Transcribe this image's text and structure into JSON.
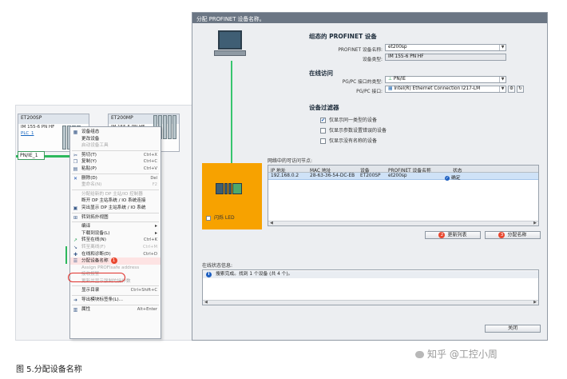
{
  "network": {
    "plc1": {
      "name": "ET200SP",
      "type": "IM 155-6 PN HF",
      "link": "PLC_1"
    },
    "plc2": {
      "name": "ET200MP",
      "type": "IM 155-5 PN HF"
    },
    "subnet": "PN/IE_1"
  },
  "context_menu": {
    "items": [
      {
        "label": "设备组态",
        "shortcut": "",
        "disabled": false,
        "icon": "device-config-icon"
      },
      {
        "label": "更改设备",
        "shortcut": "",
        "disabled": false
      },
      {
        "label": "启动设备工具",
        "shortcut": "",
        "disabled": true
      },
      {
        "sep": true
      },
      {
        "label": "剪切(T)",
        "shortcut": "Ctrl+X",
        "disabled": false,
        "icon": "scissors-icon"
      },
      {
        "label": "复制(Y)",
        "shortcut": "Ctrl+C",
        "disabled": false,
        "icon": "copy-icon"
      },
      {
        "label": "粘贴(P)",
        "shortcut": "Ctrl+V",
        "disabled": false,
        "icon": "paste-icon"
      },
      {
        "sep": true
      },
      {
        "label": "删除(D)",
        "shortcut": "Del",
        "disabled": false,
        "icon": "delete-icon"
      },
      {
        "label": "重命名(N)",
        "shortcut": "F2",
        "disabled": true
      },
      {
        "sep": true
      },
      {
        "label": "分配给新的 DP 主站/IO 控制器",
        "shortcut": "",
        "disabled": true
      },
      {
        "label": "断开 DP 主站系统 / IO 系统连接",
        "shortcut": "",
        "disabled": false
      },
      {
        "label": "突出显示 DP 主站系统 / IO 系统",
        "shortcut": "",
        "disabled": false,
        "icon": "highlight-icon"
      },
      {
        "sep": true
      },
      {
        "label": "转到拓扑视图",
        "shortcut": "",
        "disabled": false,
        "icon": "topology-icon"
      },
      {
        "sep": true
      },
      {
        "label": "编译",
        "shortcut": "",
        "disabled": false,
        "submenu": true
      },
      {
        "label": "下载到设备(L)",
        "shortcut": "",
        "disabled": false,
        "submenu": true
      },
      {
        "label": "转至在线(N)",
        "shortcut": "Ctrl+K",
        "disabled": false,
        "icon": "go-online-icon"
      },
      {
        "label": "转至离线(F)",
        "shortcut": "Ctrl+M",
        "disabled": true,
        "icon": "go-offline-icon"
      },
      {
        "label": "在线和诊断(D)",
        "shortcut": "Ctrl+D",
        "disabled": false,
        "icon": "diagnostics-icon"
      },
      {
        "label": "分配设备名称",
        "shortcut": "",
        "disabled": false,
        "highlight": true,
        "badge": "1",
        "icon": "assign-name-icon"
      },
      {
        "label": "Assign PROFIsafe address",
        "shortcut": "",
        "disabled": true
      },
      {
        "label": "接收报警",
        "shortcut": "",
        "disabled": true
      },
      {
        "label": "更新并显示强制的操作数",
        "shortcut": "",
        "disabled": true
      },
      {
        "sep": true
      },
      {
        "label": "显示目录",
        "shortcut": "Ctrl+Shift+C",
        "disabled": false
      },
      {
        "sep": true
      },
      {
        "label": "导出模块标签条(L)...",
        "shortcut": "",
        "disabled": false,
        "icon": "export-icon"
      },
      {
        "sep": true
      },
      {
        "label": "属性",
        "shortcut": "Alt+Enter",
        "disabled": false,
        "icon": "properties-icon"
      }
    ]
  },
  "dialog": {
    "title": "分配 PROFINET 设备名称。",
    "configured_title": "组态的 PROFINET 设备",
    "device_name_label": "PROFINET 设备名称:",
    "device_name_value": "et200sp",
    "device_type_label": "设备类型:",
    "device_type_value": "IM 155-6 PN HF",
    "online_access_title": "在线访问",
    "pgpc_type_label": "PG/PC 接口的类型:",
    "pgpc_type_value": "PN/IE",
    "pgpc_if_label": "PG/PC 接口:",
    "pgpc_if_value": "Intel(R) Ethernet Connection I217-LM",
    "filter_title": "设备过滤器",
    "filter_options": [
      {
        "label": "仅显示同一类型的设备",
        "checked": true
      },
      {
        "label": "仅显示参数设置错误的设备",
        "checked": false
      },
      {
        "label": "仅显示没有名称的设备",
        "checked": false
      }
    ],
    "flash_led_label": "闪烁 LED",
    "table_caption": "网络中的可访问节点:",
    "table_headers": [
      "IP 地址",
      "MAC 地址",
      "设备",
      "PROFINET 设备名称",
      "状态"
    ],
    "table_rows": [
      {
        "ip": "192.168.0.2",
        "mac": "28-63-36-54-DC-EB",
        "device": "ET200SP",
        "name": "et200sp",
        "status": "确定"
      }
    ],
    "update_list_label": "更新列表",
    "update_badge": "2",
    "assign_name_label": "分配名称",
    "assign_badge": "3",
    "online_status_caption": "在线状态信息:",
    "online_status_text": "搜索完成。找到 1 个设备 (共 4 个)。",
    "close_label": "关闭"
  },
  "figure_caption": "图 5.分配设备名称",
  "watermark": "知乎 @工控小周"
}
